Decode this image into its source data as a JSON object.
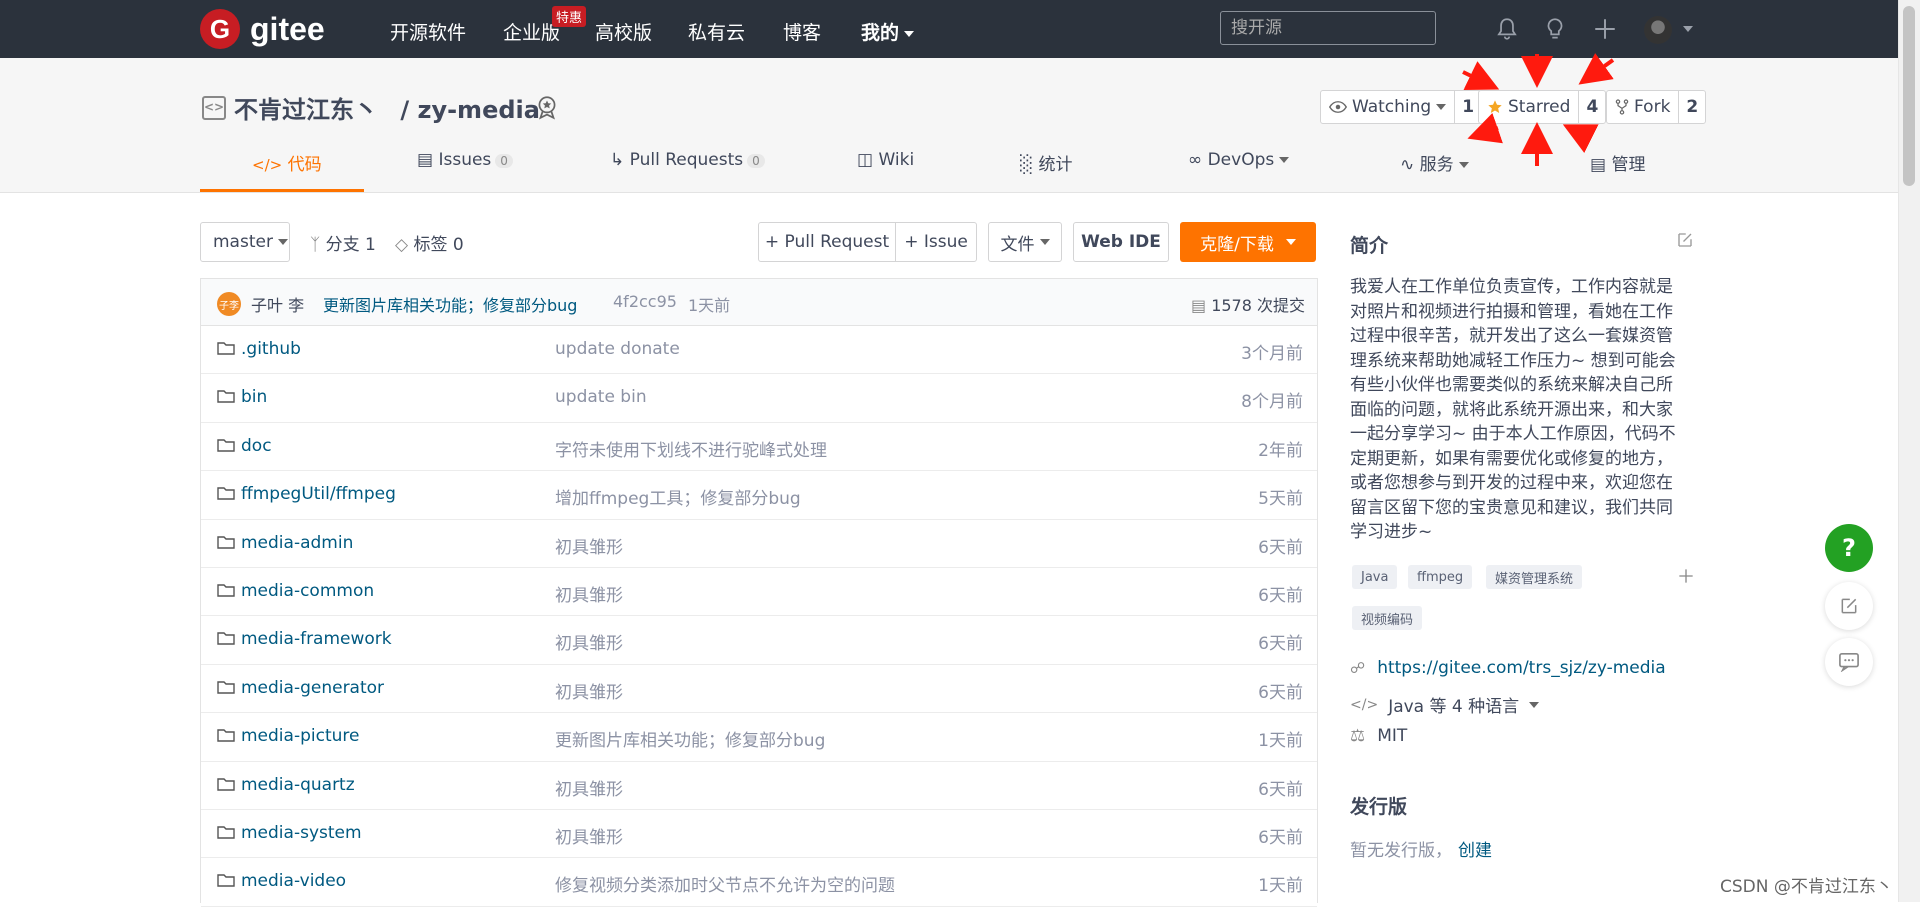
{
  "topnav": {
    "logo_text": "gitee",
    "items": [
      "开源软件",
      "企业版",
      "高校版",
      "私有云",
      "博客",
      "我的"
    ],
    "promo": "特惠",
    "search_placeholder": "搜开源"
  },
  "repo": {
    "owner": "不肯过江东丶",
    "name": "/ zy-media",
    "watching": {
      "label": "Watching",
      "count": "1"
    },
    "starred": {
      "label": "Starred",
      "count": "4"
    },
    "fork": {
      "label": "Fork",
      "count": "2"
    }
  },
  "tabs": [
    {
      "label": "代码",
      "badge": ""
    },
    {
      "label": "Issues",
      "badge": "0"
    },
    {
      "label": "Pull Requests",
      "badge": "0"
    },
    {
      "label": "Wiki",
      "badge": ""
    },
    {
      "label": "统计",
      "badge": ""
    },
    {
      "label": "DevOps",
      "badge": ""
    },
    {
      "label": "服务",
      "badge": ""
    },
    {
      "label": "管理",
      "badge": ""
    }
  ],
  "toolbar": {
    "branch": "master",
    "branches": "分支 1",
    "tags": "标签 0",
    "pull_request": "+ Pull Request",
    "issue": "+ Issue",
    "file": "文件",
    "web_ide": "Web IDE",
    "clone": "克隆/下载"
  },
  "commit": {
    "avatar_text": "子李",
    "author": "子叶 李",
    "message": "更新图片库相关功能；修复部分bug",
    "hash": "4f2cc95",
    "time": "1天前",
    "count": "1578 次提交"
  },
  "files": [
    {
      "name": ".github",
      "msg": "update donate",
      "time": "3个月前"
    },
    {
      "name": "bin",
      "msg": "update bin",
      "time": "8个月前"
    },
    {
      "name": "doc",
      "msg": "字符未使用下划线不进行驼峰式处理",
      "time": "2年前"
    },
    {
      "name": "ffmpegUtil/ffmpeg",
      "msg": "增加ffmpeg工具；修复部分bug",
      "time": "5天前"
    },
    {
      "name": "media-admin",
      "msg": "初具雏形",
      "time": "6天前"
    },
    {
      "name": "media-common",
      "msg": "初具雏形",
      "time": "6天前"
    },
    {
      "name": "media-framework",
      "msg": "初具雏形",
      "time": "6天前"
    },
    {
      "name": "media-generator",
      "msg": "初具雏形",
      "time": "6天前"
    },
    {
      "name": "media-picture",
      "msg": "更新图片库相关功能；修复部分bug",
      "time": "1天前"
    },
    {
      "name": "media-quartz",
      "msg": "初具雏形",
      "time": "6天前"
    },
    {
      "name": "media-system",
      "msg": "初具雏形",
      "time": "6天前"
    },
    {
      "name": "media-video",
      "msg": "修复视频分类添加时父节点不允许为空的问题",
      "time": "1天前"
    }
  ],
  "sidebar": {
    "intro_title": "简介",
    "intro_lines": [
      "我爱人在工作单位负责宣传，工作内容就是",
      "对照片和视频进行拍摄和管理，看她在工作",
      "过程中很辛苦，就开发出了这么一套媒资管",
      "理系统来帮助她减轻工作压力~ 想到可能会",
      "有些小伙伴也需要类似的系统来解决自己所",
      "面临的问题，就将此系统开源出来，和大家",
      "一起分享学习~ 由于本人工作原因，代码不",
      "定期更新，如果有需要优化或修复的地方，",
      "或者您想参与到开发的过程中来，欢迎您在",
      "留言区留下您的宝贵意见和建议，我们共同",
      "学习进步~"
    ],
    "tags": [
      "Java",
      "ffmpeg",
      "媒资管理系统",
      "视频编码"
    ],
    "url": "https://gitee.com/trs_sjz/zy-media",
    "languages": "Java 等 4 种语言",
    "license": "MIT",
    "release_title": "发行版",
    "release_none": "暂无发行版，",
    "release_create": "创建"
  },
  "floating": {
    "help": "?"
  },
  "watermark": "CSDN @不肯过江东丶",
  "colors": {
    "nav_bg": "#2b323c",
    "accent": "#fe7300",
    "brand": "#c71d23",
    "help": "#23a123",
    "arrow": "#ff1a0e"
  }
}
